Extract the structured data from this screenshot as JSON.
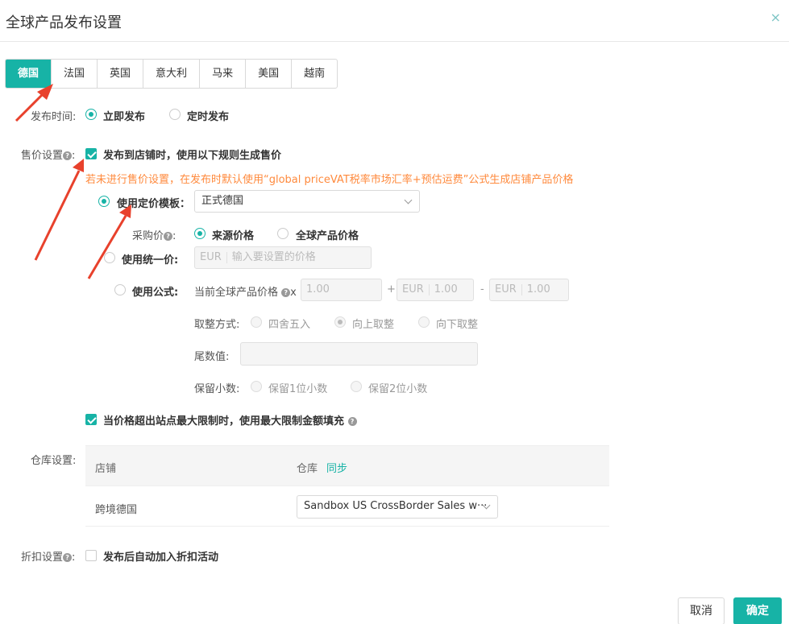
{
  "dialog": {
    "title": "全球产品发布设置",
    "close": "×"
  },
  "tabs": [
    "德国",
    "法国",
    "英国",
    "意大利",
    "马来",
    "美国",
    "越南"
  ],
  "publish_time": {
    "label": "发布时间:",
    "opt_now": "立即发布",
    "opt_scheduled": "定时发布"
  },
  "price": {
    "label": "售价设置",
    "help": "?",
    "colon": ":",
    "checkbox_label": "发布到店铺时，使用以下规则生成售价",
    "warning": "若未进行售价设置，在发布时默认使用“global priceVAT税率市场汇率+预估运费”公式生成店铺产品价格",
    "template_label": "使用定价模板：",
    "template_value": "正式德国",
    "purchase_label": "采购价",
    "purchase_src": "来源价格",
    "purchase_global": "全球产品价格",
    "unified_label": "使用统一价:",
    "unified_prefix": "EUR",
    "unified_placeholder": "输入要设置的价格",
    "formula_label": "使用公式:",
    "formula_text": "当前全球产品价格",
    "formula_x": "x",
    "formula_mult": "1.00",
    "formula_plus": "+",
    "formula_add_prefix": "EUR",
    "formula_add": "1.00",
    "formula_minus": "-",
    "formula_sub_prefix": "EUR",
    "formula_sub": "1.00",
    "rounding_label": "取整方式:",
    "round_half": "四舍五入",
    "round_up": "向上取整",
    "round_down": "向下取整",
    "tail_label": "尾数值:",
    "decimals_label": "保留小数:",
    "decimals_1": "保留1位小数",
    "decimals_2": "保留2位小数",
    "max_limit_label": "当价格超出站点最大限制时，使用最大限制金额填充"
  },
  "warehouse": {
    "label": "仓库设置:",
    "col_store": "店铺",
    "col_wh": "仓库",
    "sync": "同步",
    "rows": [
      {
        "store": "跨境德国",
        "warehouse": "Sandbox US CrossBorder Sales w···"
      }
    ]
  },
  "discount": {
    "label": "折扣设置",
    "help": "?",
    "colon": ":",
    "checkbox_label": "发布后自动加入折扣活动"
  },
  "footer": {
    "cancel": "取消",
    "ok": "确定"
  },
  "colors": {
    "accent": "#17b3a6",
    "warning": "#ff8a3d",
    "arrow": "#e8412c"
  }
}
